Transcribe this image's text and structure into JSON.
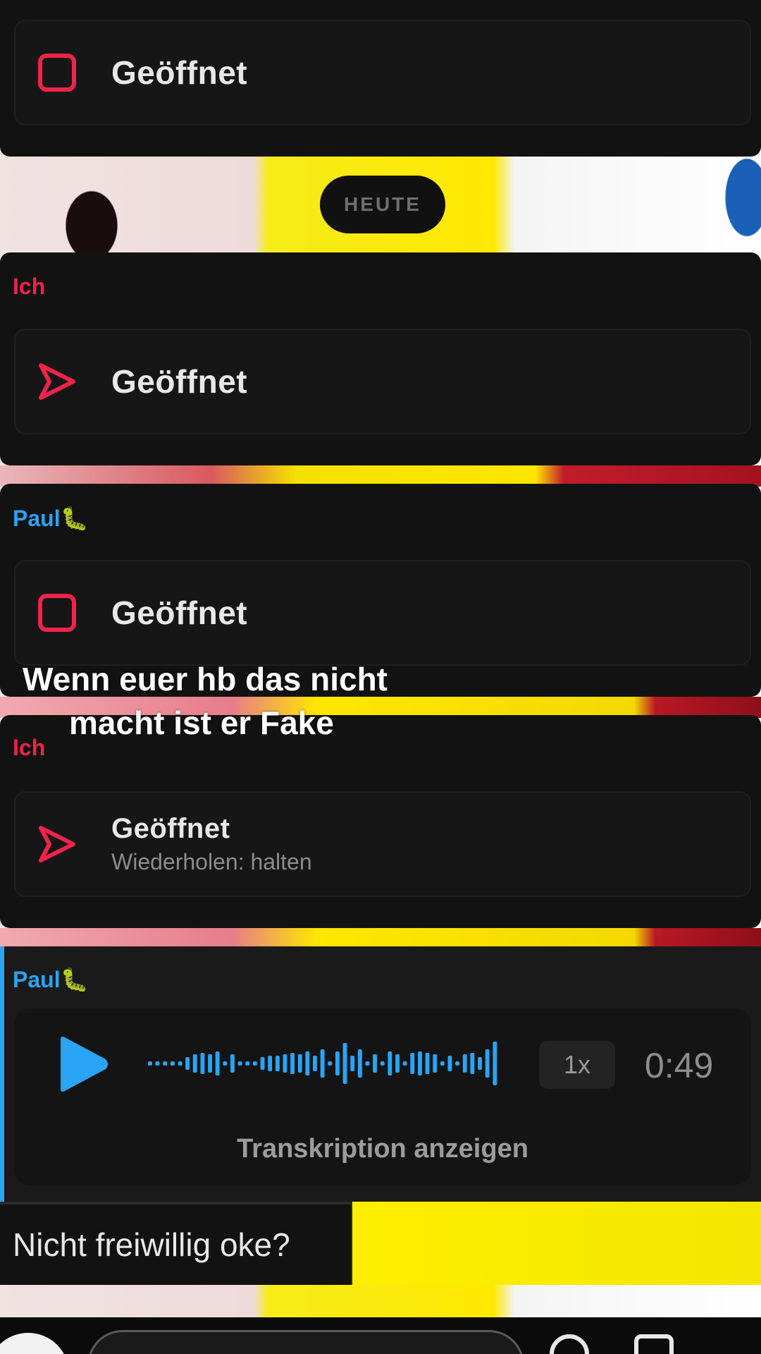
{
  "top_message": {
    "status": "Geöffnet"
  },
  "date_separator": "HEUTE",
  "messages": [
    {
      "sender": "Ich",
      "status": "Geöffnet"
    },
    {
      "sender": "Paul🐛",
      "status": "Geöffnet"
    },
    {
      "sender": "Ich",
      "status": "Geöffnet",
      "hint": "Wiederholen: halten"
    }
  ],
  "caption": {
    "line1": "Wenn euer hb das nicht",
    "line2": "macht ist er Fake"
  },
  "voice_note": {
    "sender": "Paul🐛",
    "speed": "1x",
    "duration": "0:49",
    "transcript_label": "Transkription anzeigen"
  },
  "reply": {
    "text": "Nicht freiwillig oke?"
  },
  "colors": {
    "me_accent": "#f0234a",
    "paul_accent": "#2aa4f4",
    "background": "#121212"
  }
}
